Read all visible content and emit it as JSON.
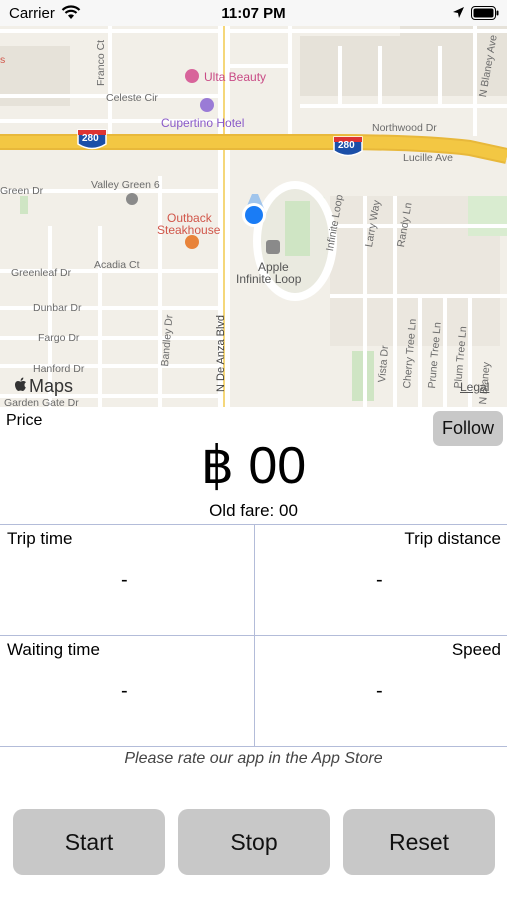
{
  "status_bar": {
    "carrier": "Carrier",
    "time": "11:07 PM"
  },
  "map": {
    "labels": {
      "franco": "Franco Ct",
      "celeste": "Celeste Cir",
      "ulta": "Ulta Beauty",
      "cupertino_hotel": "Cupertino Hotel",
      "hwy1": "280",
      "hwy2": "280",
      "northwood": "Northwood Dr",
      "lucille": "Lucille Ave",
      "blaney_top": "N Blaney Ave",
      "green": "Green Dr",
      "valley_green": "Valley Green 6",
      "outback1": "Outback",
      "outback2": "Steakhouse",
      "infinite_loop_road": "Infinite Loop",
      "larry": "Larry Way",
      "randy": "Randy Ln",
      "apple1": "Apple",
      "apple2": "Infinite Loop",
      "greenleaf": "Greenleaf Dr",
      "acadia": "Acadia Ct",
      "dunbar": "Dunbar Dr",
      "fargo": "Fargo Dr",
      "hanford": "Hanford Dr",
      "garden_gate": "Garden Gate Dr",
      "bandley": "Bandley Dr",
      "de_anza": "N De Anza Blvd",
      "cherry": "Cherry Tree Ln",
      "prune": "Prune Tree Ln",
      "vista": "Vista Dr",
      "plum": "Plum Tree Ln",
      "blaney_bottom": "N Blaney",
      "edge": "s"
    },
    "logo_text": "Maps",
    "legal": "Legal",
    "colors": {
      "highway": "#f3c743",
      "water": "#a6d3f0",
      "park": "#cfe5c4",
      "location": "#1a7cf5"
    }
  },
  "price": {
    "label": "Price",
    "follow_button": "Follow",
    "value": "฿ 00",
    "old_fare": "Old fare: 00"
  },
  "stats": {
    "trip_time": {
      "label": "Trip time",
      "value": "-"
    },
    "trip_distance": {
      "label": "Trip distance",
      "value": "-"
    },
    "waiting_time": {
      "label": "Waiting time",
      "value": "-"
    },
    "speed": {
      "label": "Speed",
      "value": "-"
    }
  },
  "rate_text": "Please rate our app in the App Store",
  "buttons": {
    "start": "Start",
    "stop": "Stop",
    "reset": "Reset"
  }
}
